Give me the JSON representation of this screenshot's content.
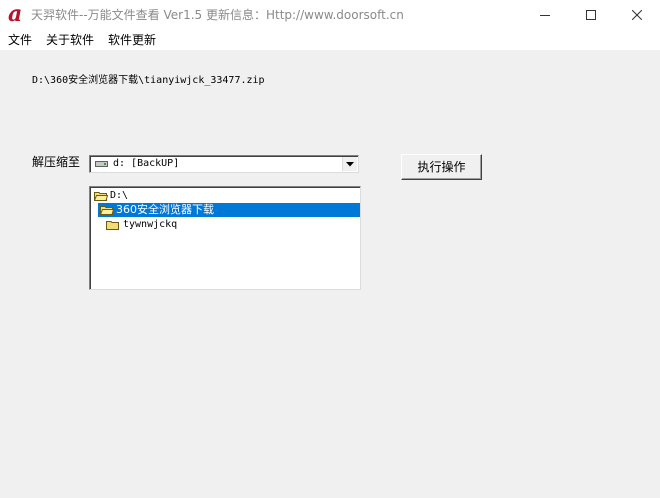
{
  "window": {
    "app_icon_glyph": "a",
    "title": "天羿软件--万能文件查看 Ver1.5  更新信息：Http://www.doorsoft.cn"
  },
  "menu": {
    "items": [
      {
        "label": "文件"
      },
      {
        "label": "关于软件"
      },
      {
        "label": "软件更新"
      }
    ]
  },
  "main": {
    "file_path": "D:\\360安全浏览器下载\\tianyiwjck_33477.zip",
    "extract_label": "解压缩至",
    "drive_select": {
      "value": "d: [BackUP]"
    },
    "execute_button": "执行操作",
    "directory_tree": [
      {
        "label": "D:\\",
        "state": "open",
        "selected": false
      },
      {
        "label": "360安全浏览器下载",
        "state": "open",
        "selected": true
      },
      {
        "label": "tywnwjckq",
        "state": "closed",
        "selected": false
      }
    ]
  },
  "colors": {
    "selection": "#0078d7",
    "app_icon": "#b8122c",
    "folder": "#f3dc76",
    "window_bg": "#f0f0f0"
  },
  "icons": {
    "app": "app-logo-icon",
    "minimize": "minimize-icon",
    "maximize": "maximize-icon",
    "close": "close-icon",
    "drive": "hard-drive-icon",
    "dropdown": "chevron-down-icon",
    "folder_open": "folder-open-icon",
    "folder_closed": "folder-icon"
  }
}
